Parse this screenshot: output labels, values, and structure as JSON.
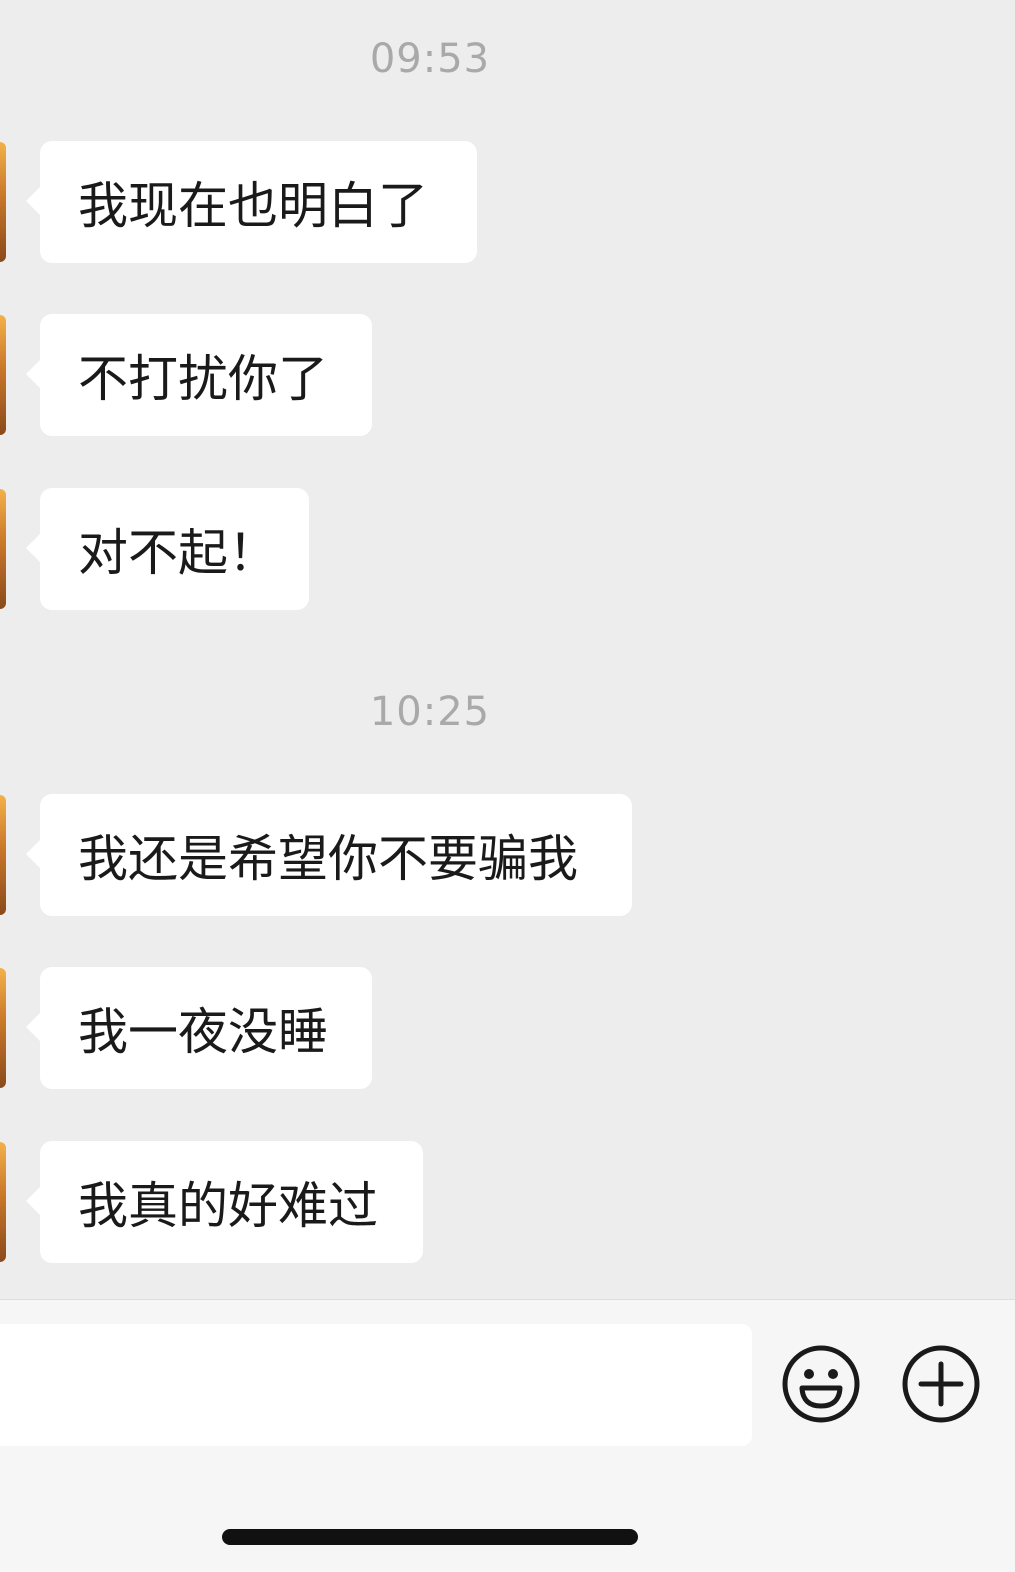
{
  "conversation": {
    "groups": [
      {
        "timestamp": "09:53",
        "messages": [
          {
            "text": "我现在也明白了"
          },
          {
            "text": "不打扰你了"
          },
          {
            "text": "对不起！"
          }
        ]
      },
      {
        "timestamp": "10:25",
        "messages": [
          {
            "text": "我还是希望你不要骗我"
          },
          {
            "text": "我一夜没睡"
          },
          {
            "text": "我真的好难过"
          }
        ]
      }
    ]
  },
  "input_bar": {
    "message_value": "",
    "emoji_icon": "emoji-icon",
    "add_icon": "plus-icon"
  },
  "colors": {
    "background": "#ededed",
    "bubble": "#ffffff",
    "timestamp_text": "#a9a9a9",
    "message_text": "#1a1a1a"
  }
}
